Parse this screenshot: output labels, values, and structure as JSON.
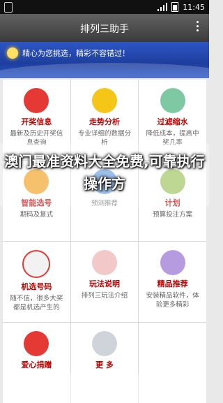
{
  "status": {
    "time": "11:45"
  },
  "appbar": {
    "title": "排列三助手"
  },
  "banner": {
    "text": "精心为您挑选，精彩不容错过！"
  },
  "grid": [
    {
      "label": "开奖信息",
      "desc": "最新及历史开奖信息查询",
      "icon": "trophy-icon",
      "color": "#e53935"
    },
    {
      "label": "走势分析",
      "desc": "专业详细的数据分析",
      "icon": "chart-icon",
      "color": "#f5c518"
    },
    {
      "label": "过滤缩水",
      "desc": "降低成本，提高中奖几率",
      "icon": "diamond-icon",
      "color": "#7ec9a3"
    },
    {
      "label": "智能选号",
      "desc": "期码及复式",
      "icon": "smart-icon",
      "color": "#f0a020"
    },
    {
      "label": "",
      "desc": "预测推荐",
      "icon": "predict-icon",
      "color": "#6aa0e0"
    },
    {
      "label": "计划",
      "desc": "预算投注方案",
      "icon": "plan-icon",
      "color": "#9cc35a"
    },
    {
      "label": "机选号码",
      "desc": "随不信，很多大奖都是机选产生的",
      "icon": "target-icon",
      "color": "#f2f2f2"
    },
    {
      "label": "玩法说明",
      "desc": "排列三玩法介绍",
      "icon": "book-icon",
      "color": "#f3c8c8"
    },
    {
      "label": "精品推荐",
      "desc": "安装精品软件，体验更多精彩",
      "icon": "robot-icon",
      "color": "#b79be0"
    },
    {
      "label": "爱心捐赠",
      "desc": "",
      "icon": "heart-icon",
      "color": "#e53935"
    },
    {
      "label": "更 多",
      "desc": "",
      "icon": "more-icon",
      "color": "#cfd3da"
    },
    {
      "label": "",
      "desc": "",
      "icon": "",
      "color": "#ffffff"
    }
  ],
  "overlay": {
    "text": "澳门最准资料大全免费,可靠执行操作方"
  }
}
